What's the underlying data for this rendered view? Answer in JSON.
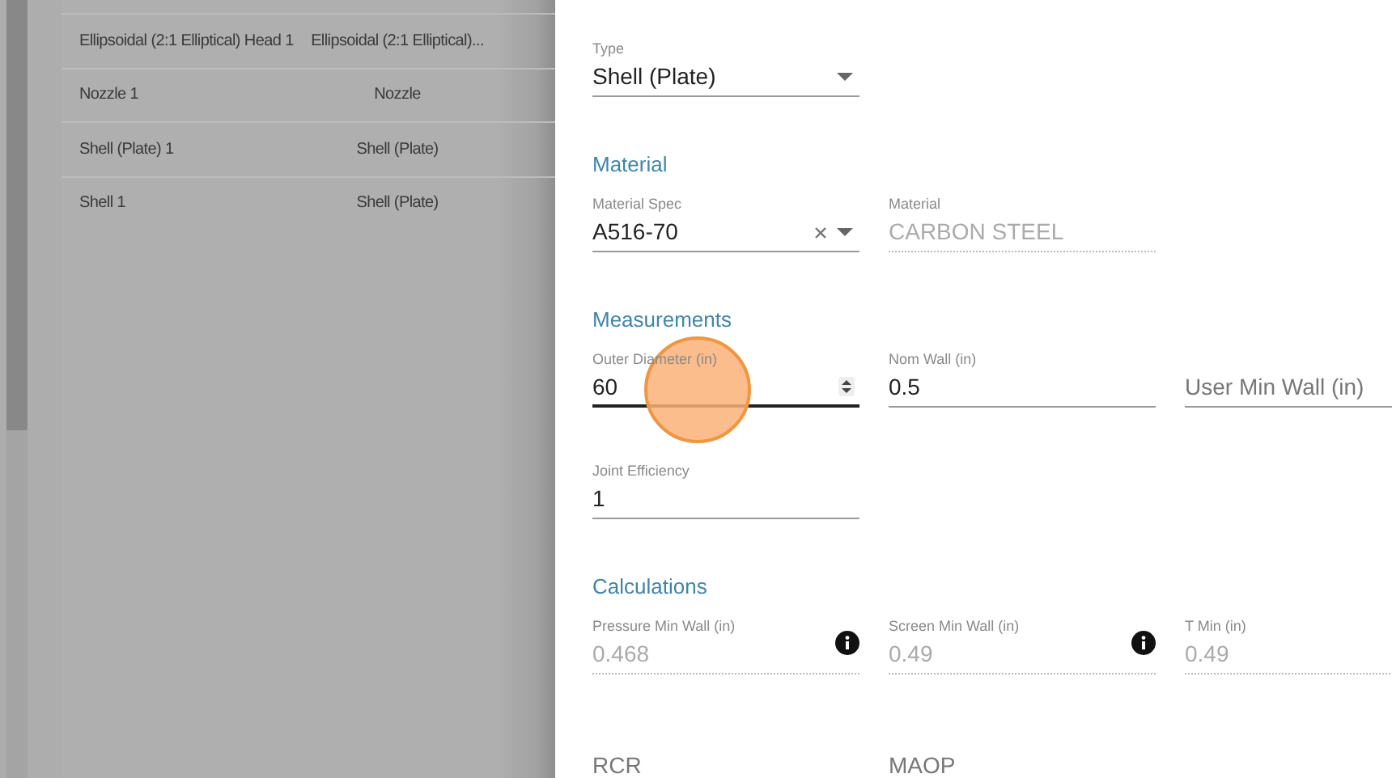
{
  "table": {
    "rows": [
      {
        "name": "Ellipsoidal (2:1 Elliptical) Head 1",
        "type": "Ellipsoidal (2:1 Elliptical)..."
      },
      {
        "name": "Nozzle 1",
        "type": "Nozzle"
      },
      {
        "name": "Shell (Plate) 1",
        "type": "Shell (Plate)"
      },
      {
        "name": "Shell 1",
        "type": "Shell (Plate)"
      }
    ]
  },
  "panel": {
    "type_field": {
      "kind": "select",
      "label": "Type",
      "value": "Shell (Plate)",
      "focused": false
    },
    "sections": [
      {
        "title": "Material",
        "rows": [
          {
            "fields": [
              {
                "kind": "select_clearable",
                "label": "Material Spec",
                "value": "A516-70",
                "focused": false
              },
              {
                "kind": "readonly",
                "label": "Material",
                "value": "CARBON STEEL"
              }
            ]
          }
        ]
      },
      {
        "title": "Measurements",
        "rows": [
          {
            "fields": [
              {
                "kind": "spinner",
                "label": "Outer Diameter (in)",
                "value": "60",
                "focused": true
              },
              {
                "kind": "input",
                "label": "Nom Wall (in)",
                "value": "0.5",
                "focused": false
              },
              {
                "kind": "input",
                "placeholder": "User Min Wall (in)",
                "focused": false
              }
            ]
          },
          {
            "fields": [
              {
                "kind": "input",
                "label": "Joint Efficiency",
                "value": "1",
                "focused": false
              }
            ]
          }
        ]
      },
      {
        "title": "Calculations",
        "rows": [
          {
            "fields": [
              {
                "kind": "readonly_info",
                "label": "Pressure Min Wall (in)",
                "value": "0.468"
              },
              {
                "kind": "readonly_info",
                "label": "Screen Min Wall (in)",
                "value": "0.49"
              },
              {
                "kind": "readonly",
                "label": "T Min (in)",
                "value": "0.49"
              }
            ]
          },
          {
            "fields": [
              {
                "kind": "input",
                "placeholder": "RCR",
                "focused": false
              },
              {
                "kind": "input",
                "placeholder": "MAOP",
                "focused": false
              }
            ]
          }
        ]
      }
    ]
  }
}
